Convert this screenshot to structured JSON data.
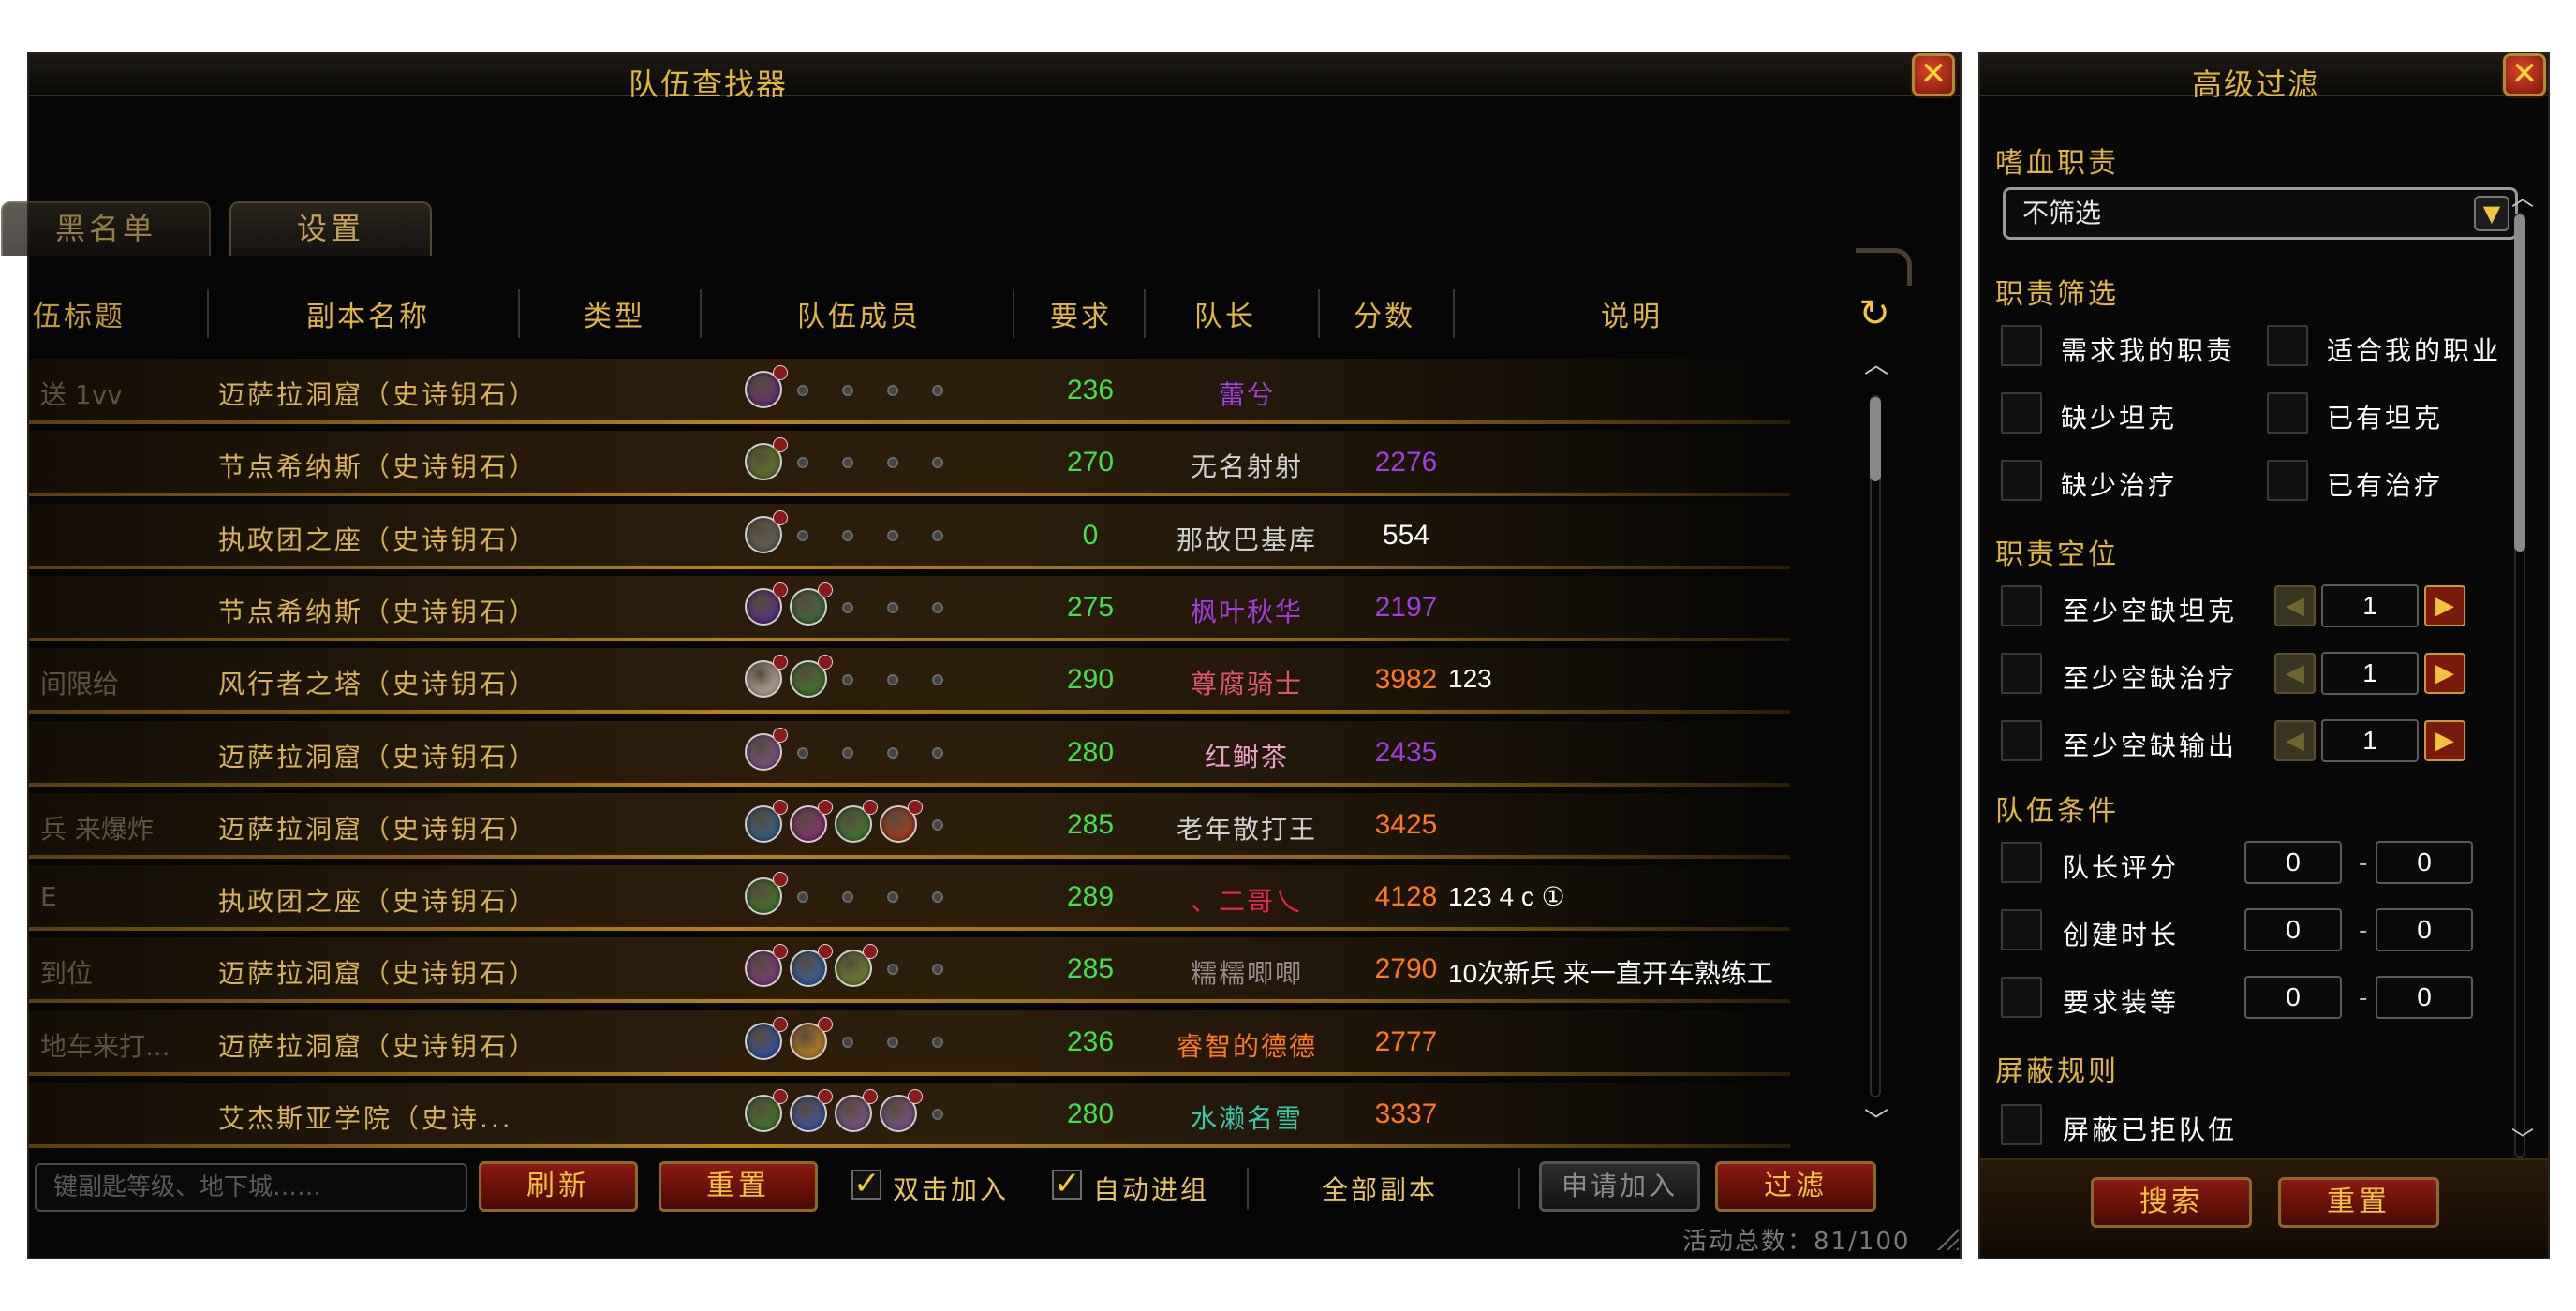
{
  "main_window": {
    "title": "队伍查找器",
    "tabs": [
      {
        "label": "黑名单"
      },
      {
        "label": "设置"
      }
    ],
    "columns": [
      "伍标题",
      "副本名称",
      "类型",
      "队伍成员",
      "要求",
      "队长",
      "分数",
      "说明"
    ],
    "rows": [
      {
        "title": "送 1vv",
        "dungeon": "迈萨拉洞窟（史诗钥石）",
        "requirement": "236",
        "leader": "蕾兮",
        "leader_color": "#a23de0",
        "score": "",
        "score_color": "#ffffff",
        "note": "",
        "members": [
          "#6d2a8a"
        ]
      },
      {
        "title": "",
        "dungeon": "节点希纳斯（史诗钥石）",
        "requirement": "270",
        "leader": "无名射射",
        "leader_color": "#cfcfcf",
        "score": "2276",
        "score_color": "#a23de0",
        "note": "",
        "members": [
          "#6a8a2a"
        ]
      },
      {
        "title": "",
        "dungeon": "执政团之座（史诗钥石）",
        "requirement": "0",
        "leader": "那故巴基库",
        "leader_color": "#cfcfcf",
        "score": "554",
        "score_color": "#ffffff",
        "note": "",
        "members": [
          "#6a6a6a"
        ]
      },
      {
        "title": "",
        "dungeon": "节点希纳斯（史诗钥石）",
        "requirement": "275",
        "leader": "枫叶秋华",
        "leader_color": "#a23de0",
        "score": "2197",
        "score_color": "#a23de0",
        "note": "",
        "members": [
          "#5a2a9a",
          "#3a7a3a"
        ]
      },
      {
        "title": "间限给",
        "dungeon": "风行者之塔（史诗钥石）",
        "requirement": "290",
        "leader": "尊腐骑士",
        "leader_color": "#e0566a",
        "score": "3982",
        "score_color": "#ff7a1a",
        "note": "123",
        "members": [
          "#e8d8c8",
          "#3a8a2a"
        ]
      },
      {
        "title": "",
        "dungeon": "迈萨拉洞窟（史诗钥石）",
        "requirement": "280",
        "leader": "红鲥茶",
        "leader_color": "#e8a0c8",
        "score": "2435",
        "score_color": "#a23de0",
        "note": "",
        "members": [
          "#8a5aa8"
        ]
      },
      {
        "title": "兵 来爆炸",
        "dungeon": "迈萨拉洞窟（史诗钥石）",
        "requirement": "285",
        "leader": "老年散打王",
        "leader_color": "#cfcfcf",
        "score": "3425",
        "score_color": "#ff7a1a",
        "note": "",
        "members": [
          "#2a6aa8",
          "#9a2a8a",
          "#3a8a2a",
          "#c83a1a"
        ]
      },
      {
        "title": "E",
        "dungeon": "执政团之座（史诗钥石）",
        "requirement": "289",
        "leader": "、二哥乀",
        "leader_color": "#e0284a",
        "score": "4128",
        "score_color": "#ff7a1a",
        "note": "123  4 c ①",
        "members": [
          "#3a8a2a"
        ]
      },
      {
        "title": "到位",
        "dungeon": "迈萨拉洞窟（史诗钥石）",
        "requirement": "285",
        "leader": "糯糯唧唧",
        "leader_color": "#9a8a8a",
        "score": "2790",
        "score_color": "#ff7a1a",
        "note": "10次新兵 来一直开车熟练工",
        "members": [
          "#8a3a9a",
          "#2a6ac8",
          "#7a9a2a"
        ]
      },
      {
        "title": "地车来打...",
        "dungeon": "迈萨拉洞窟（史诗钥石）",
        "requirement": "236",
        "leader": "睿智的德德",
        "leader_color": "#ff7a1a",
        "score": "2777",
        "score_color": "#ff7a1a",
        "note": "",
        "members": [
          "#2a5ac8",
          "#e89a1a"
        ]
      },
      {
        "title": "",
        "dungeon": "艾杰斯亚学院（史诗...",
        "requirement": "280",
        "leader": "水濑名雪",
        "leader_color": "#3ac8a8",
        "score": "3337",
        "score_color": "#ff7a1a",
        "note": "",
        "members": [
          "#3a8a2a",
          "#3a5ac8",
          "#8a5aa8",
          "#8a5aa8"
        ]
      }
    ],
    "search": {
      "placeholder": "键副匙等级、地下城……"
    },
    "buttons": {
      "refresh": "刷新",
      "reset": "重置",
      "apply": "申请加入",
      "filter": "过滤"
    },
    "checkboxes": {
      "double_click_join": "双击加入",
      "auto_group": "自动进组"
    },
    "all_dungeons": "全部副本",
    "status": "活动总数：81/100",
    "close_glyph": "✕",
    "refresh_glyph": "↻"
  },
  "filter_window": {
    "title": "高级过滤",
    "sections": {
      "role_type": "嗜血职责",
      "role_filter": "职责筛选",
      "role_slots": "职责空位",
      "group_conditions": "队伍条件",
      "block_rules": "屏蔽规则"
    },
    "dropdown_value": "不筛选",
    "role_filter_options": [
      "需求我的职责",
      "适合我的职业",
      "缺少坦克",
      "已有坦克",
      "缺少治疗",
      "已有治疗"
    ],
    "slot_rows": [
      {
        "label": "至少空缺坦克",
        "value": "1"
      },
      {
        "label": "至少空缺治疗",
        "value": "1"
      },
      {
        "label": "至少空缺输出",
        "value": "1"
      }
    ],
    "condition_rows": [
      {
        "label": "队长评分",
        "min": "0",
        "max": "0"
      },
      {
        "label": "创建时长",
        "min": "0",
        "max": "0"
      },
      {
        "label": "要求装等",
        "min": "0",
        "max": "0"
      }
    ],
    "block_option": "屏蔽已拒队伍",
    "dash": "-",
    "buttons": {
      "search": "搜索",
      "reset": "重置"
    },
    "colors": {
      "accent": "#e2b53c",
      "button_red": "#8b1a10"
    }
  }
}
